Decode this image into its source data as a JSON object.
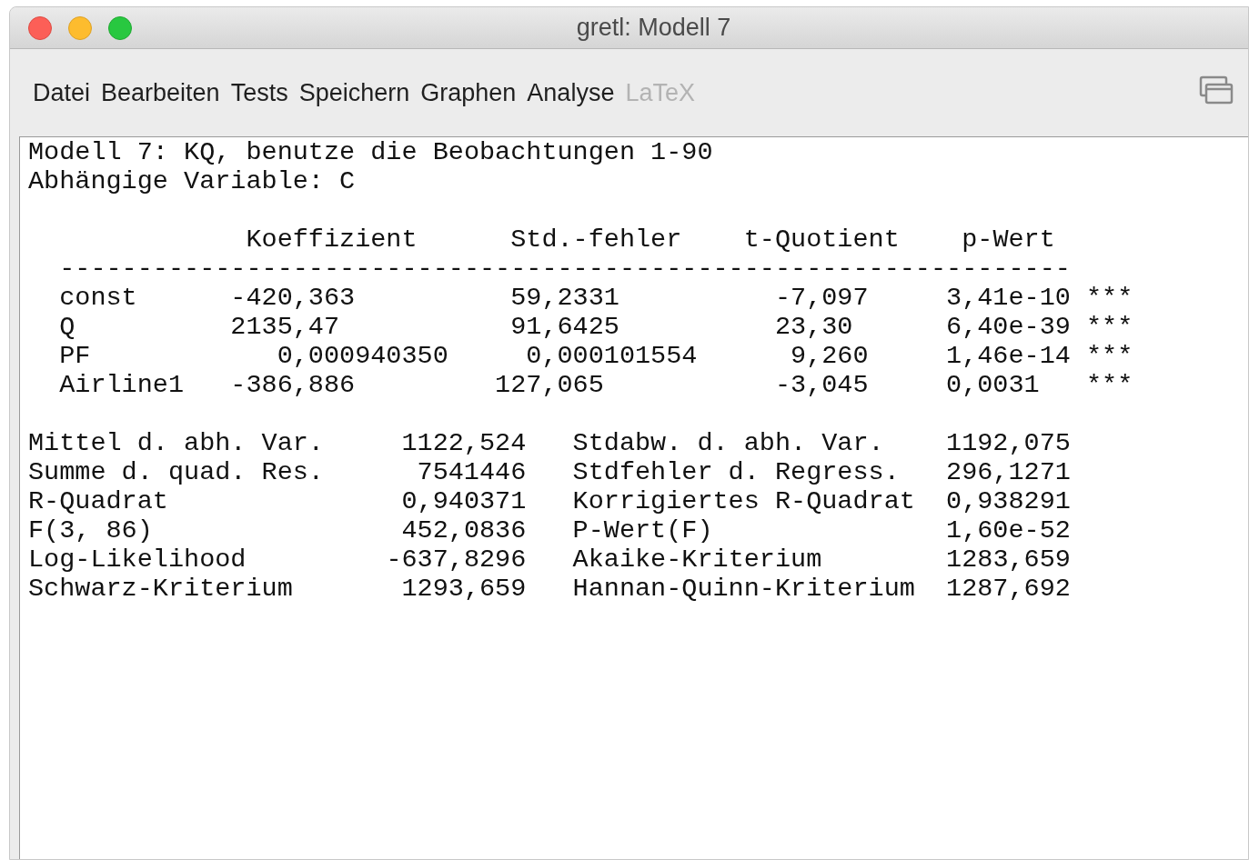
{
  "window": {
    "title": "gretl: Modell 7"
  },
  "menu": [
    {
      "label": "Datei",
      "disabled": false
    },
    {
      "label": "Bearbeiten",
      "disabled": false
    },
    {
      "label": "Tests",
      "disabled": false
    },
    {
      "label": "Speichern",
      "disabled": false
    },
    {
      "label": "Graphen",
      "disabled": false
    },
    {
      "label": "Analyse",
      "disabled": false
    },
    {
      "label": "LaTeX",
      "disabled": true
    }
  ],
  "output": {
    "heading": [
      "Modell 7: KQ, benutze die Beobachtungen 1-90",
      "Abhängige Variable: C"
    ],
    "columns": [
      "Koeffizient",
      "Std.-fehler",
      "t-Quotient",
      "p-Wert"
    ],
    "separator": "-----------------------------------------------------------------",
    "rows": [
      {
        "name": "const",
        "coef": "-420,363",
        "se": "59,2331",
        "t": "-7,097",
        "p": "3,41e-10",
        "stars": "***"
      },
      {
        "name": "Q",
        "coef": "2135,47",
        "se": "91,6425",
        "t": "23,30",
        "p": "6,40e-39",
        "stars": "***"
      },
      {
        "name": "PF",
        "coef": "0,000940350",
        "se": "0,000101554",
        "t": "9,260",
        "p": "1,46e-14",
        "stars": "***"
      },
      {
        "name": "Airline1",
        "coef": "-386,886",
        "se": "127,065",
        "t": "-3,045",
        "p": "0,0031",
        "stars": "***"
      }
    ],
    "stats": [
      {
        "label": "Mittel d. abh. Var.",
        "value": "1122,524",
        "label2": "Stdabw. d. abh. Var.",
        "value2": "1192,075"
      },
      {
        "label": "Summe d. quad. Res.",
        "value": "7541446",
        "label2": "Stdfehler d. Regress.",
        "value2": "296,1271"
      },
      {
        "label": "R-Quadrat",
        "value": "0,940371",
        "label2": "Korrigiertes R-Quadrat",
        "value2": "0,938291"
      },
      {
        "label": "F(3, 86)",
        "value": "452,0836",
        "label2": "P-Wert(F)",
        "value2": "1,60e-52"
      },
      {
        "label": "Log-Likelihood",
        "value": "-637,8296",
        "label2": "Akaike-Kriterium",
        "value2": "1283,659"
      },
      {
        "label": "Schwarz-Kriterium",
        "value": "1293,659",
        "label2": "Hannan-Quinn-Kriterium",
        "value2": "1287,692"
      }
    ]
  }
}
